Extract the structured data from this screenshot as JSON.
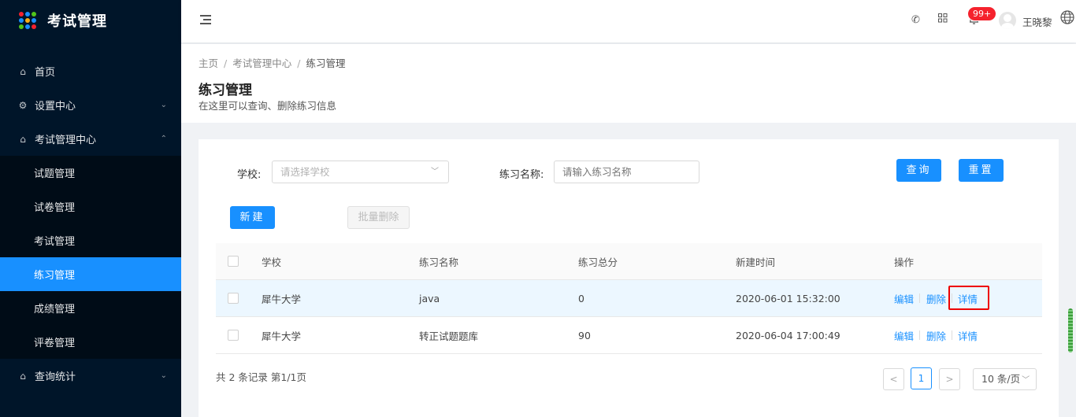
{
  "app": {
    "title": "考试管理",
    "logo_colors": [
      "#f5222d",
      "#1890ff",
      "#52c41a",
      "#1890ff",
      "#faad14",
      "#1890ff",
      "#52c41a",
      "#1890ff",
      "#f5222d"
    ]
  },
  "sidebar": {
    "items": [
      {
        "label": "首页",
        "icon": "home-icon"
      },
      {
        "label": "设置中心",
        "icon": "gear-icon"
      },
      {
        "label": "考试管理中心",
        "icon": "home-icon"
      },
      {
        "label": "试题管理"
      },
      {
        "label": "试卷管理"
      },
      {
        "label": "考试管理"
      },
      {
        "label": "练习管理"
      },
      {
        "label": "成绩管理"
      },
      {
        "label": "评卷管理"
      },
      {
        "label": "查询统计",
        "icon": "home-icon"
      }
    ]
  },
  "topbar": {
    "notification_count": "99+",
    "username": "王晓黎"
  },
  "breadcrumb": {
    "home": "主页",
    "parent": "考试管理中心",
    "current": "练习管理",
    "sep": "/"
  },
  "page": {
    "title": "练习管理",
    "description": "在这里可以查询、删除练习信息"
  },
  "filters": {
    "school_label": "学校:",
    "school_placeholder": "请选择学校",
    "name_label": "练习名称:",
    "name_placeholder": "请输入练习名称",
    "query_button": "查询",
    "reset_button": "重置",
    "new_button": "新建",
    "batch_delete_button": "批量删除"
  },
  "table": {
    "headers": [
      "学校",
      "练习名称",
      "练习总分",
      "新建时间",
      "操作"
    ],
    "rows": [
      {
        "school": "犀牛大学",
        "name": "java",
        "score": "0",
        "created": "2020-06-01 15:32:00"
      },
      {
        "school": "犀牛大学",
        "name": "转正试题题库",
        "score": "90",
        "created": "2020-06-04 17:00:49"
      }
    ],
    "actions": {
      "edit": "编辑",
      "delete": "删除",
      "detail": "详情"
    }
  },
  "pagination": {
    "summary": "共 2 条记录 第1/1页",
    "prev": "<",
    "page": "1",
    "next": ">",
    "page_size": "10 条/页"
  },
  "colors": {
    "primary": "#1890ff",
    "sidebar_bg": "#001529",
    "highlight_box": "#e00000"
  }
}
